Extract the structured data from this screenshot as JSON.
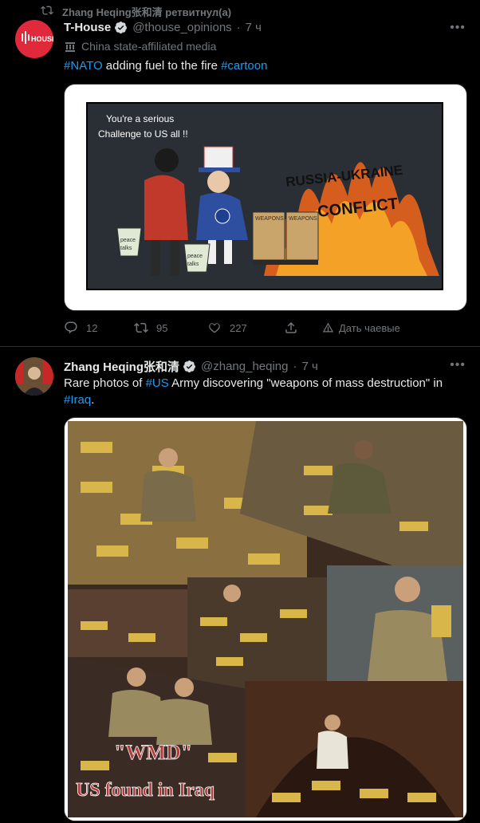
{
  "tweet1": {
    "retweet_text": "Zhang Heqing张和清 ретвитнул(а)",
    "avatar_text": "HOUSE",
    "name": "T-House",
    "handle": "@thouse_opinions",
    "dot": "·",
    "time": "7 ч",
    "label": "China state-affiliated media",
    "text_link1": "#NATO",
    "text_mid": " adding fuel to the fire ",
    "text_link2": "#cartoon",
    "cartoon": {
      "speech": "You're a serious Challenge to US all !!",
      "conflict_title": "RUSSIA-UKRAINE CONFLICT",
      "bucket1": "peace talks",
      "bucket2": "peace talks",
      "barrel1": "WEAPONS",
      "barrel2": "WEAPONS"
    },
    "actions": {
      "replies": "12",
      "retweets": "95",
      "likes": "227",
      "tip": "Дать чаевые"
    }
  },
  "tweet2": {
    "name": "Zhang Heqing张和清",
    "handle": "@zhang_heqing",
    "dot": "·",
    "time": "7 ч",
    "text_a": "Rare photos of ",
    "text_link1": "#US",
    "text_b": " Army discovering \"weapons of mass destruction\" in ",
    "text_link2": "#Iraq",
    "text_c": ".",
    "collage": {
      "wmd": "\"WMD\"",
      "caption": "US found in Iraq"
    }
  },
  "colors": {
    "bg": "#000000",
    "text": "#e7e9ea",
    "secondary": "#71767b",
    "link": "#1d9bf0",
    "avatar_red": "#e0293a"
  }
}
